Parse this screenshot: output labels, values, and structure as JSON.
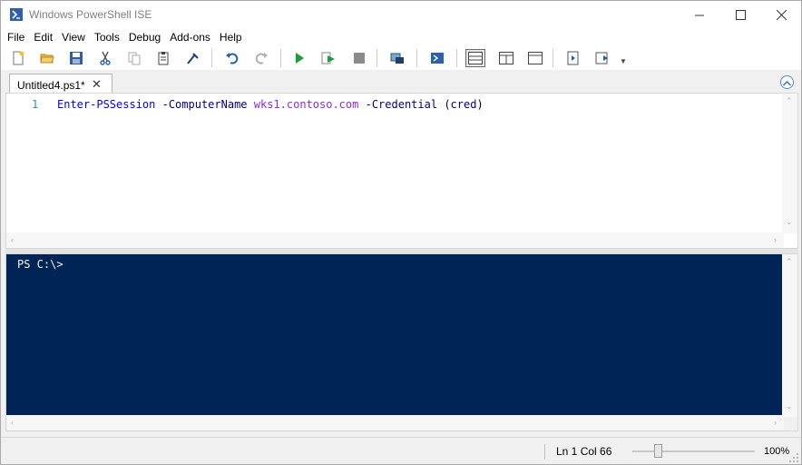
{
  "window": {
    "title": "Windows PowerShell ISE"
  },
  "menu": {
    "items": [
      "File",
      "Edit",
      "View",
      "Tools",
      "Debug",
      "Add-ons",
      "Help"
    ]
  },
  "toolbar": {
    "buttons": [
      "new-script-icon",
      "open-icon",
      "save-icon",
      "cut-icon",
      "copy-icon",
      "paste-icon",
      "clear-console-icon",
      "undo-icon",
      "redo-icon",
      "run-script-icon",
      "run-selection-icon",
      "stop-icon",
      "remote-powershell-icon",
      "powershell-tab-icon",
      "show-script-top-icon",
      "show-script-right-icon",
      "show-script-max-icon",
      "show-commands-icon",
      "show-addon-icon"
    ]
  },
  "tabs": [
    {
      "label": "Untitled4.ps1*"
    }
  ],
  "script": {
    "line_number": "1",
    "tokens": {
      "cmdlet": "Enter-PSSession",
      "param1": "-ComputerName",
      "value1": "wks1.contoso.com",
      "param2": "-Credential",
      "open_paren": "(",
      "var": "cred",
      "close_paren": ")"
    }
  },
  "console": {
    "prompt": "PS C:\\>",
    "background_color": "#012456"
  },
  "status": {
    "position": "Ln 1  Col 66",
    "zoom": "100%"
  }
}
